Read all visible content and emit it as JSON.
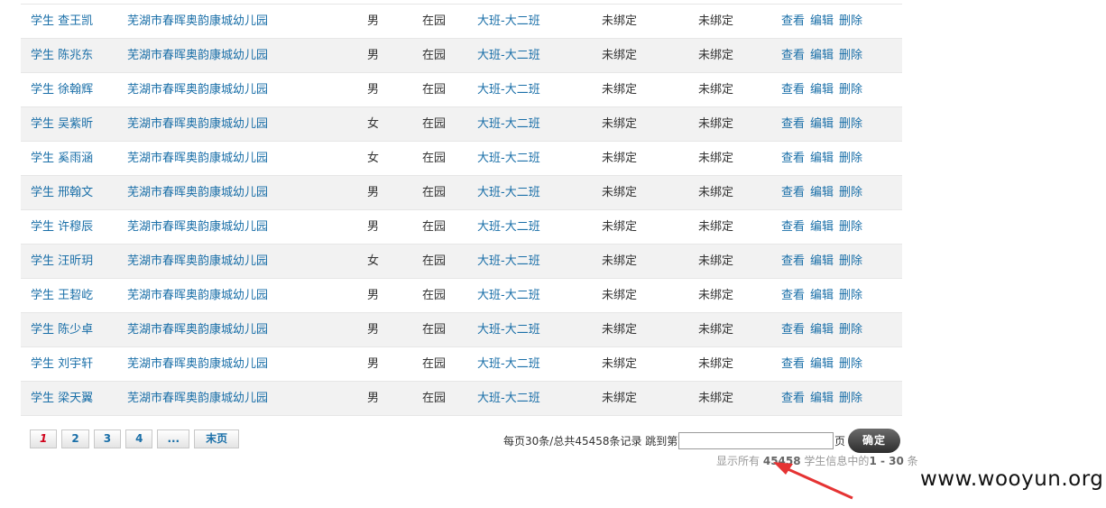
{
  "rows": [
    {
      "name": "学生 查王凯",
      "school": "芜湖市春晖奥韵康城幼儿园",
      "gender": "男",
      "status": "在园",
      "class": "大班-大二班",
      "bind1": "未绑定",
      "bind2": "未绑定"
    },
    {
      "name": "学生 陈兆东",
      "school": "芜湖市春晖奥韵康城幼儿园",
      "gender": "男",
      "status": "在园",
      "class": "大班-大二班",
      "bind1": "未绑定",
      "bind2": "未绑定"
    },
    {
      "name": "学生 徐翰辉",
      "school": "芜湖市春晖奥韵康城幼儿园",
      "gender": "男",
      "status": "在园",
      "class": "大班-大二班",
      "bind1": "未绑定",
      "bind2": "未绑定"
    },
    {
      "name": "学生 吴紫昕",
      "school": "芜湖市春晖奥韵康城幼儿园",
      "gender": "女",
      "status": "在园",
      "class": "大班-大二班",
      "bind1": "未绑定",
      "bind2": "未绑定"
    },
    {
      "name": "学生 奚雨涵",
      "school": "芜湖市春晖奥韵康城幼儿园",
      "gender": "女",
      "status": "在园",
      "class": "大班-大二班",
      "bind1": "未绑定",
      "bind2": "未绑定"
    },
    {
      "name": "学生 邢翰文",
      "school": "芜湖市春晖奥韵康城幼儿园",
      "gender": "男",
      "status": "在园",
      "class": "大班-大二班",
      "bind1": "未绑定",
      "bind2": "未绑定"
    },
    {
      "name": "学生 许穆辰",
      "school": "芜湖市春晖奥韵康城幼儿园",
      "gender": "男",
      "status": "在园",
      "class": "大班-大二班",
      "bind1": "未绑定",
      "bind2": "未绑定"
    },
    {
      "name": "学生 汪昕玥",
      "school": "芜湖市春晖奥韵康城幼儿园",
      "gender": "女",
      "status": "在园",
      "class": "大班-大二班",
      "bind1": "未绑定",
      "bind2": "未绑定"
    },
    {
      "name": "学生 王䂮屹",
      "school": "芜湖市春晖奥韵康城幼儿园",
      "gender": "男",
      "status": "在园",
      "class": "大班-大二班",
      "bind1": "未绑定",
      "bind2": "未绑定"
    },
    {
      "name": "学生 陈少卓",
      "school": "芜湖市春晖奥韵康城幼儿园",
      "gender": "男",
      "status": "在园",
      "class": "大班-大二班",
      "bind1": "未绑定",
      "bind2": "未绑定"
    },
    {
      "name": "学生 刘宇轩",
      "school": "芜湖市春晖奥韵康城幼儿园",
      "gender": "男",
      "status": "在园",
      "class": "大班-大二班",
      "bind1": "未绑定",
      "bind2": "未绑定"
    },
    {
      "name": "学生 梁天翼",
      "school": "芜湖市春晖奥韵康城幼儿园",
      "gender": "男",
      "status": "在园",
      "class": "大班-大二班",
      "bind1": "未绑定",
      "bind2": "未绑定"
    }
  ],
  "actions": {
    "view": "查看",
    "edit": "编辑",
    "delete": "删除"
  },
  "pagination": {
    "pages": [
      "1",
      "2",
      "3",
      "4",
      "...",
      "末页"
    ],
    "current": "1",
    "summary": "每页30条/总共45458条记录  跳到第",
    "page_unit": "页",
    "ok_label": "确定",
    "jump_value": "",
    "showall_prefix": "显示所有",
    "showall_total": "45458",
    "showall_mid": "学生信息中的",
    "showall_range": "1 - 30",
    "showall_suffix": "条"
  },
  "watermark": "www.wooyun.org",
  "colors": {
    "link": "#1a6fa8",
    "arrow": "#e53333",
    "active_page": "#d0021b"
  }
}
